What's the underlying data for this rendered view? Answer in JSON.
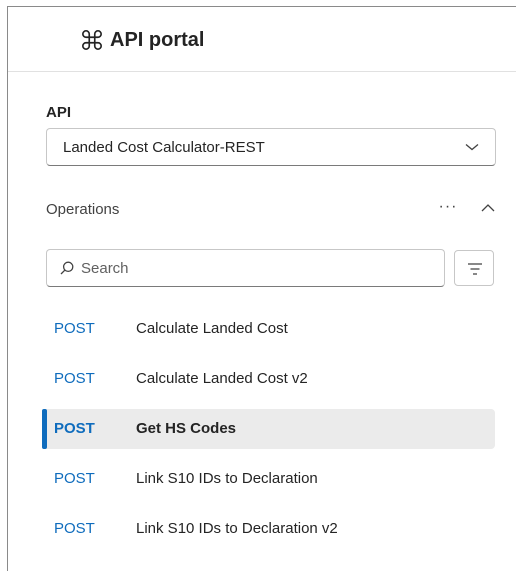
{
  "header": {
    "title": "API portal",
    "logo_icon": "command-icon"
  },
  "api": {
    "label": "API",
    "selected": "Landed Cost Calculator-REST"
  },
  "operations": {
    "label": "Operations",
    "more_label": "···"
  },
  "search": {
    "placeholder": "Search",
    "value": ""
  },
  "items": [
    {
      "method": "POST",
      "name": "Calculate Landed Cost",
      "selected": false
    },
    {
      "method": "POST",
      "name": "Calculate Landed Cost v2",
      "selected": false
    },
    {
      "method": "POST",
      "name": "Get HS Codes",
      "selected": true
    },
    {
      "method": "POST",
      "name": "Link S10 IDs to Declaration",
      "selected": false
    },
    {
      "method": "POST",
      "name": "Link S10 IDs to Declaration v2",
      "selected": false
    }
  ],
  "colors": {
    "accent": "#0f6cbd",
    "selected_bg": "#ebebeb",
    "border": "#c7c7c7"
  }
}
